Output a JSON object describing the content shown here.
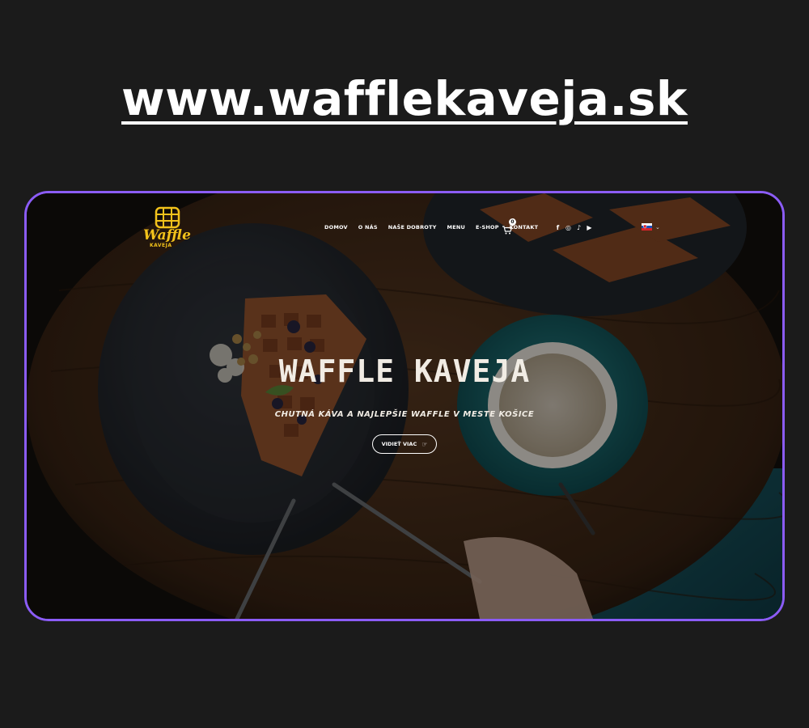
{
  "banner": {
    "url_text": "www.wafflekaveja.sk"
  },
  "brand": {
    "logo_word_1": "Waffle",
    "logo_word_2": "KAVEJA",
    "logo_color": "#f2c21b"
  },
  "nav": {
    "items": [
      {
        "label": "DOMOV"
      },
      {
        "label": "O NÁS"
      },
      {
        "label": "NAŠE DOBROTY"
      },
      {
        "label": "MENU"
      },
      {
        "label": "E-SHOP"
      },
      {
        "label": "KONTAKT"
      }
    ],
    "cart_count": "0",
    "socials": [
      {
        "icon": "facebook-icon",
        "glyph": "f"
      },
      {
        "icon": "instagram-icon",
        "glyph": "◎"
      },
      {
        "icon": "tiktok-icon",
        "glyph": "♪"
      },
      {
        "icon": "youtube-icon",
        "glyph": "▶"
      }
    ],
    "language_flag": "slovak-flag-icon"
  },
  "hero": {
    "title": "WAFFLE KAVEJA",
    "subtitle": "CHUTNÁ KÁVA A NAJLEPŠIE WAFFLE V MESTE KOŠICE",
    "cta_label": "VIDIEŤ VIAC"
  },
  "colors": {
    "frame_border": "#8b5cf6",
    "page_background": "#1b1b1b"
  }
}
